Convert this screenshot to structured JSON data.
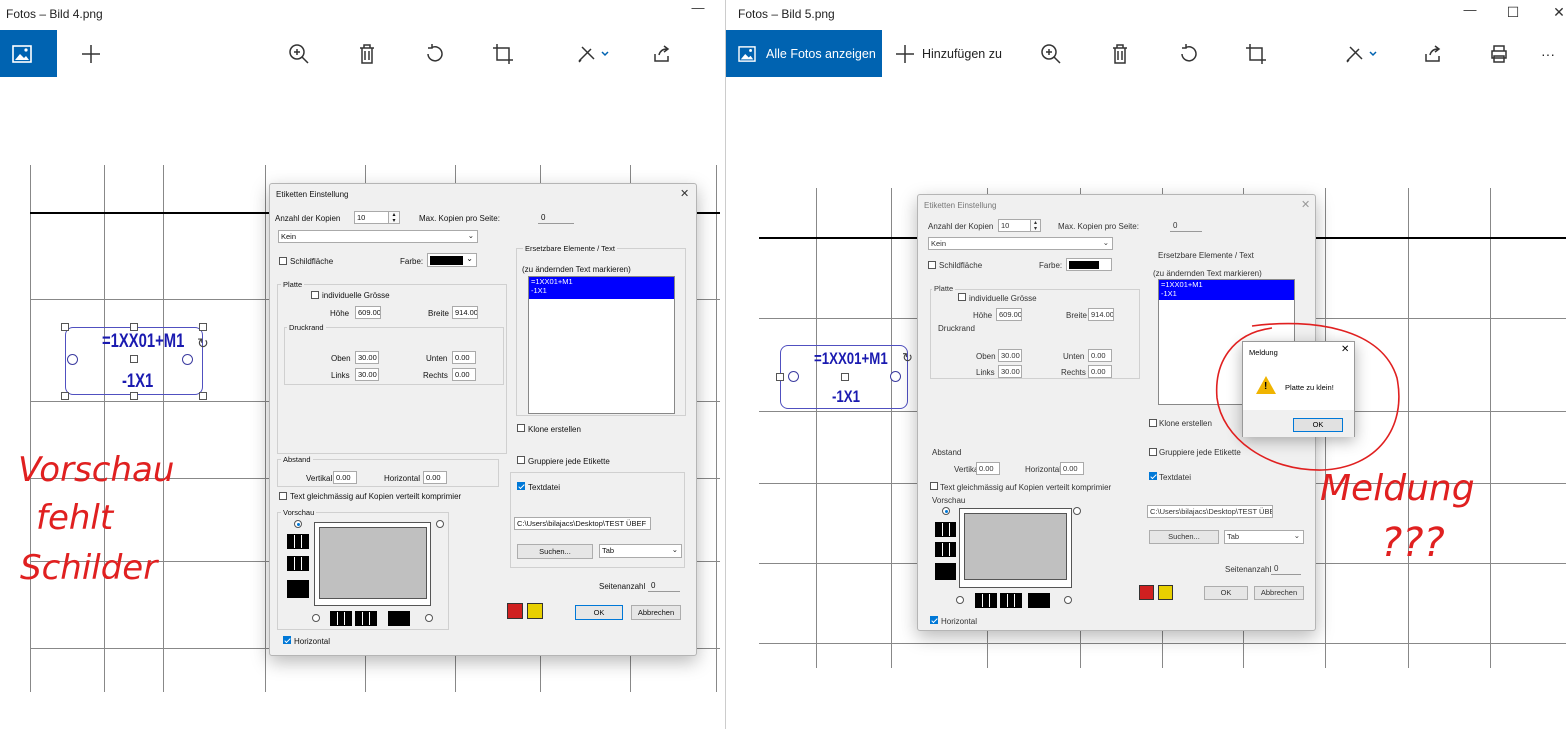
{
  "left_window": {
    "title": "Fotos – Bild 4.png",
    "minimize_symbol": "—",
    "dialog": {
      "title": "Etiketten Einstellung",
      "copies_label": "Anzahl der Kopien",
      "copies_value": "10",
      "max_copies_label": "Max. Kopien pro Seite:",
      "max_copies_value": "0",
      "select_value": "Kein",
      "shield_label": "Schildfläche",
      "color_label": "Farbe:",
      "plate_group": "Platte",
      "individual_size": "individuelle Grösse",
      "height_label": "Höhe",
      "height_value": "609.00",
      "width_label": "Breite",
      "width_value": "914.00",
      "print_margin_group": "Druckrand",
      "top_label": "Oben",
      "top_value": "30.00",
      "bottom_label": "Unten",
      "bottom_value": "0.00",
      "left_label": "Links",
      "left_value": "30.00",
      "right_label": "Rechts",
      "right_value": "0.00",
      "distance_group": "Abstand",
      "vertical_label": "Vertikal",
      "vertical_value": "0.00",
      "horizontal_label": "Horizontal",
      "horizontal_value": "0.00",
      "text_even": "Text gleichmässig auf Kopien verteilt komprimier",
      "preview_group": "Vorschau",
      "horizontal_cb": "Horizontal",
      "replace_group": "Ersetzbare Elemente / Text",
      "replace_hint": "(zu ändernden Text markieren)",
      "list_items": [
        "=1XX01+M1",
        "-1X1"
      ],
      "clone": "Klone erstellen",
      "group_each": "Gruppiere jede Etikette",
      "textfile": "Textdatei",
      "path": "C:\\Users\\bilajacs\\Desktop\\TEST ÜBEF",
      "search_btn": "Suchen...",
      "tab_value": "Tab",
      "pages_label": "Seitenanzahl",
      "pages_value": "0",
      "ok": "OK",
      "cancel": "Abbrechen"
    },
    "label_line1": "=1XX01+M1",
    "label_line2": "-1X1",
    "annotation": [
      "Vorschau",
      "fehlt",
      "Schilder"
    ]
  },
  "right_window": {
    "title": "Fotos – Bild 5.png",
    "minimize_symbol": "—",
    "maximize_symbol": "☐",
    "close_symbol": "✕",
    "toolbar": {
      "show_all": "Alle Fotos anzeigen",
      "add_to": "Hinzufügen zu",
      "more": "···"
    },
    "label_line1": "=1XX01+M1",
    "label_line2": "-1X1",
    "message": {
      "title": "Meldung",
      "text": "Platte zu klein!",
      "ok": "OK"
    },
    "annotation": [
      "Meldung",
      "???"
    ]
  },
  "colors": {
    "accent": "#0063b1",
    "selection": "#0000ff",
    "annotation_red": "#e02020",
    "label_blue": "#1a1ab0"
  },
  "icons": [
    "photo-icon",
    "plus-icon",
    "zoom-in-icon",
    "delete-icon",
    "rotate-icon",
    "crop-icon",
    "edit-icon",
    "share-icon",
    "print-icon",
    "warning-icon"
  ]
}
